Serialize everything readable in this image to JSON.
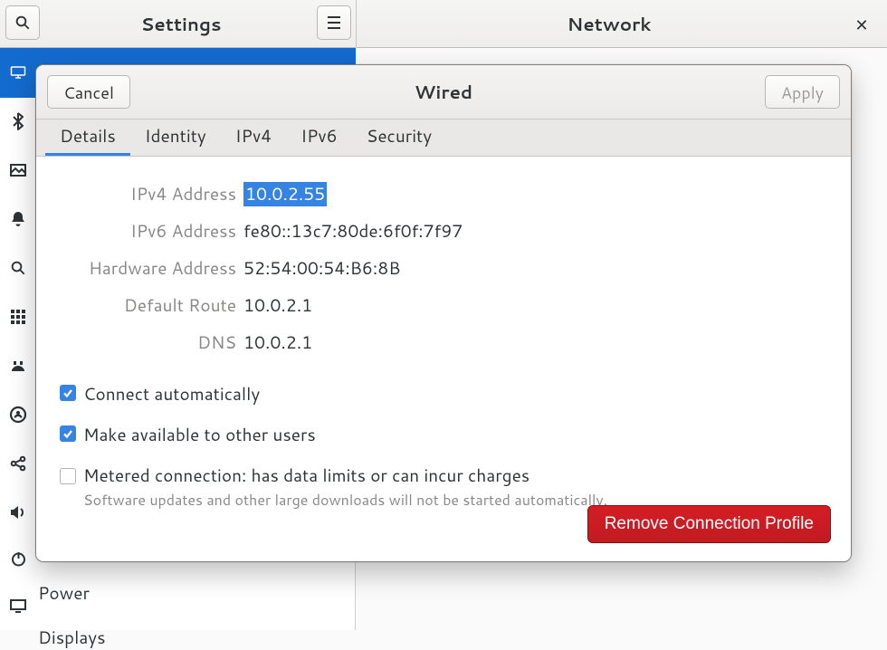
{
  "bg": {
    "settings_title": "Settings",
    "right_title": "Network"
  },
  "sidebar": {
    "items": [
      {
        "label": "Power"
      },
      {
        "label": "Displays"
      }
    ]
  },
  "dialog": {
    "title": "Wired",
    "cancel_label": "Cancel",
    "apply_label": "Apply",
    "tabs": [
      {
        "label": "Details",
        "active": true
      },
      {
        "label": "Identity"
      },
      {
        "label": "IPv4"
      },
      {
        "label": "IPv6"
      },
      {
        "label": "Security"
      }
    ],
    "details": {
      "ipv4_label": "IPv4 Address",
      "ipv4_value": "10.0.2.55",
      "ipv6_label": "IPv6 Address",
      "ipv6_value": "fe80::13c7:80de:6f0f:7f97",
      "hw_label": "Hardware Address",
      "hw_value": "52:54:00:54:B6:8B",
      "route_label": "Default Route",
      "route_value": "10.0.2.1",
      "dns_label": "DNS",
      "dns_value": "10.0.2.1"
    },
    "checks": {
      "auto_label": "Connect automatically",
      "auto_checked": true,
      "share_label": "Make available to other users",
      "share_checked": true,
      "metered_label": "Metered connection: has data limits or can incur charges",
      "metered_sub": "Software updates and other large downloads will not be started automatically.",
      "metered_checked": false
    },
    "remove_label": "Remove Connection Profile"
  }
}
